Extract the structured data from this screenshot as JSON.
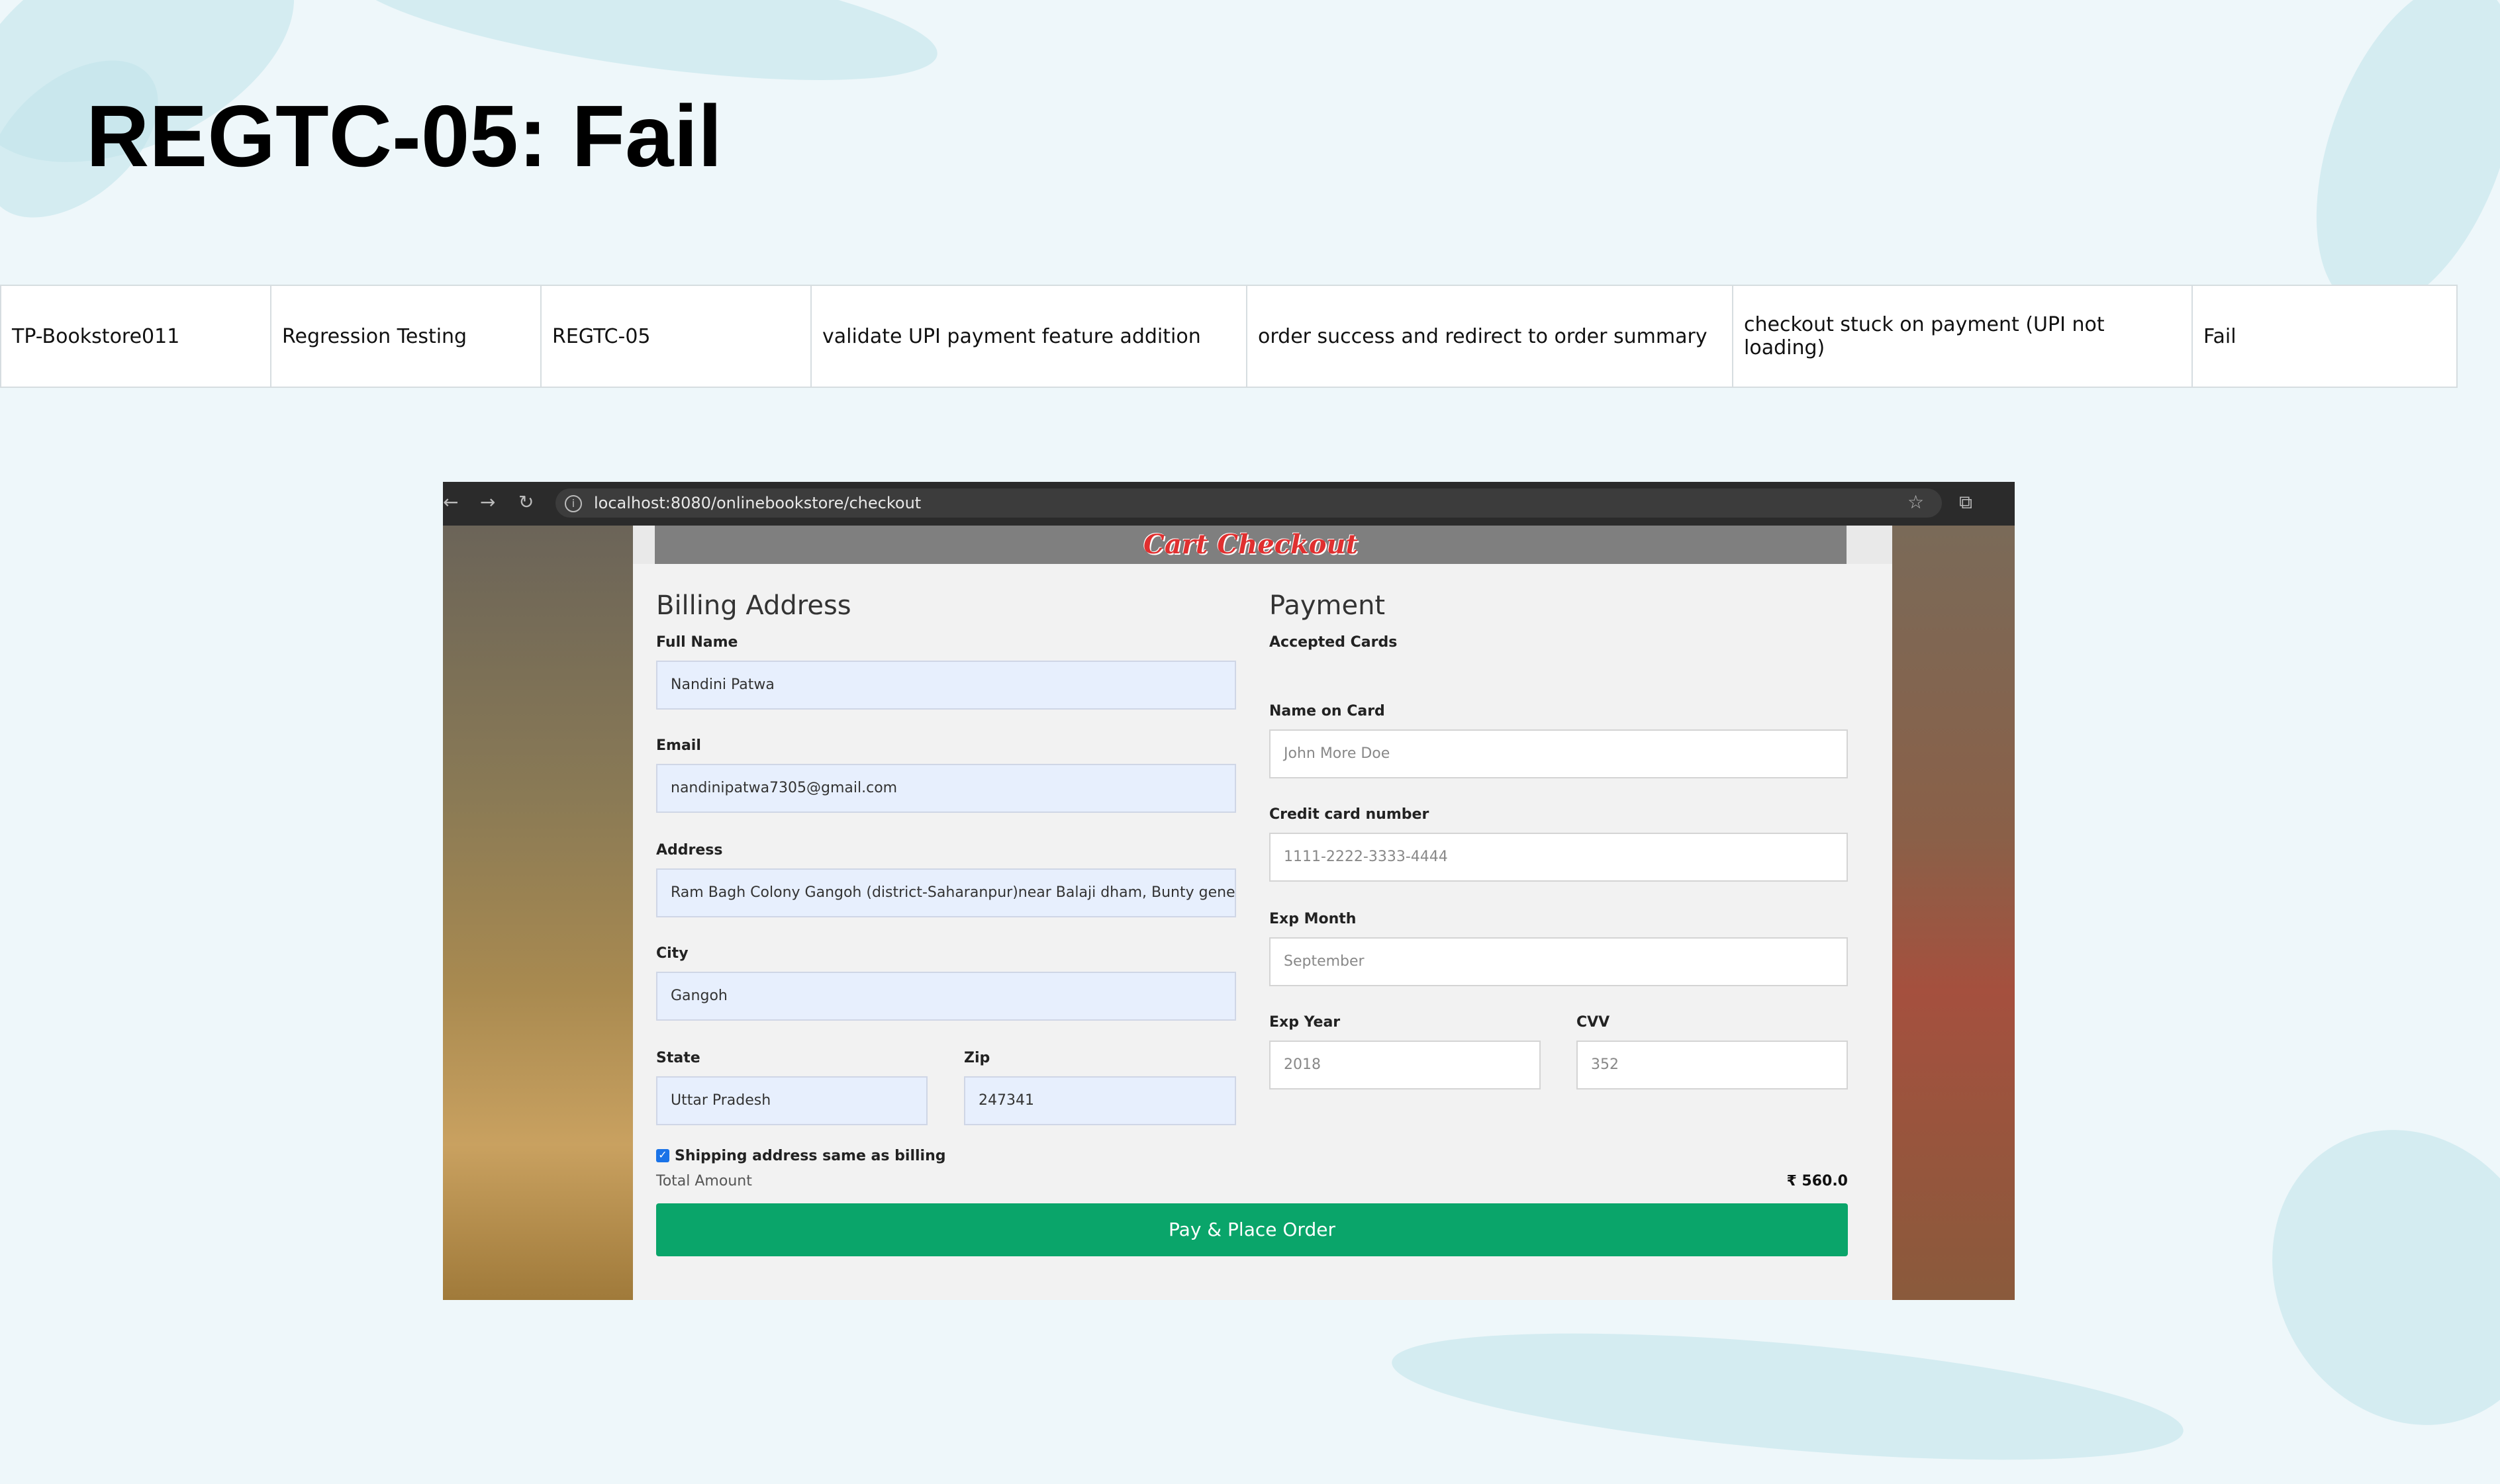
{
  "slide": {
    "title": "REGTC-05: Fail"
  },
  "test_case": {
    "cells": [
      "TP-Bookstore011",
      "Regression Testing",
      "REGTC-05",
      "validate UPI payment feature addition",
      "order success and redirect to order summary",
      "checkout stuck on payment (UPI not loading)",
      "Fail"
    ]
  },
  "browser": {
    "url": "localhost:8080/onlinebookstore/checkout",
    "icons": [
      "back-arrow-icon",
      "forward-arrow-icon",
      "reload-icon",
      "info-icon",
      "star-icon",
      "extensions-icon"
    ]
  },
  "checkout": {
    "header": "Cart Checkout",
    "billing": {
      "title": "Billing Address",
      "full_name_label": "Full Name",
      "full_name": "Nandini Patwa",
      "email_label": "Email",
      "email": "nandinipatwa7305@gmail.com",
      "address_label": "Address",
      "address": "Ram Bagh Colony Gangoh (district-Saharanpur)near Balaji dham, Bunty general stc",
      "city_label": "City",
      "city": "Gangoh",
      "state_label": "State",
      "state": "Uttar Pradesh",
      "zip_label": "Zip",
      "zip": "247341"
    },
    "payment": {
      "title": "Payment",
      "accepted_cards_label": "Accepted Cards",
      "name_on_card_label": "Name on Card",
      "name_on_card_placeholder": "John More Doe",
      "card_number_label": "Credit card number",
      "card_number_placeholder": "1111-2222-3333-4444",
      "exp_month_label": "Exp Month",
      "exp_month_placeholder": "September",
      "exp_year_label": "Exp Year",
      "exp_year_placeholder": "2018",
      "cvv_label": "CVV",
      "cvv_placeholder": "352"
    },
    "shipping_same_label": "Shipping address same as billing",
    "total_label": "Total Amount",
    "total_value": "₹ 560.0",
    "pay_button": "Pay & Place Order"
  },
  "colors": {
    "pay_button": "#0aa56a",
    "header_text": "#e03030",
    "input_filled_bg": "#e7effd"
  }
}
